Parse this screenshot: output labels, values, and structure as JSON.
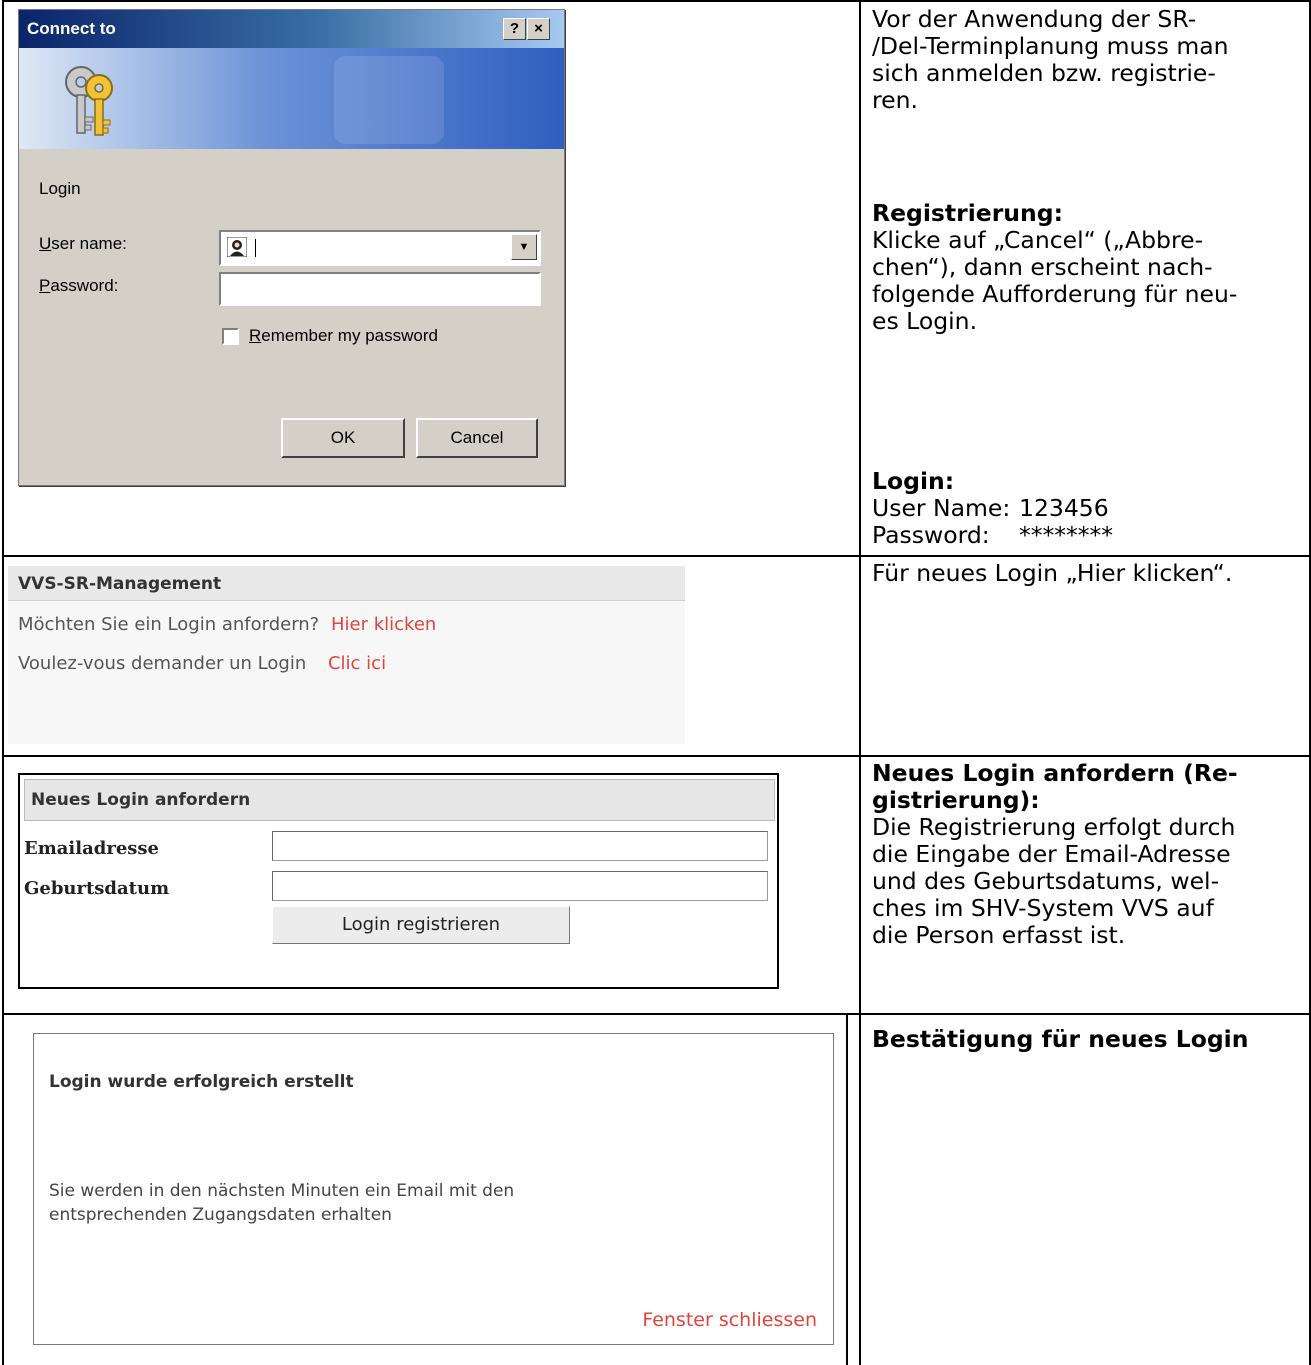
{
  "dialog": {
    "title": "Connect to",
    "help_btn": "?",
    "close_btn": "×",
    "section_label": "Login",
    "user_label_u": "U",
    "user_label_rest": "ser name:",
    "password_label_u": "P",
    "password_label_rest": "assword:",
    "remember_u": "R",
    "remember_rest": "emember my password",
    "ok": "OK",
    "cancel": "Cancel"
  },
  "desc1": {
    "intro": [
      "Vor der Anwendung der SR-",
      "/Del-Terminplanung muss man",
      "sich anmelden bzw. registrie-",
      "ren."
    ],
    "reg_heading": "Registrierung:",
    "reg_text": [
      "Klicke auf „Cancel“ („Abbre-",
      "chen“), dann erscheint nach-",
      "folgende Aufforderung für neu-",
      "es Login."
    ],
    "login_heading": "Login:",
    "user_key": "User Name:",
    "user_val": "123456",
    "pass_key": "Password:",
    "pass_val": "********"
  },
  "vvs": {
    "header": "VVS-SR-Management",
    "q_de": "Möchten Sie ein Login anfordern?",
    "link_de": "Hier klicken",
    "q_fr": "Voulez-vous demander un Login",
    "link_fr": "Clic ici"
  },
  "desc2": {
    "text": "Für neues Login „Hier klicken“."
  },
  "nla": {
    "header": "Neues Login anfordern",
    "email_label": "Emailadresse",
    "birth_label": "Geburtsdatum",
    "button": "Login registrieren"
  },
  "desc3": {
    "heading": [
      "Neues Login anfordern (Re-",
      "gistrierung):"
    ],
    "text": [
      "Die Registrierung erfolgt durch",
      "die Eingabe der Email-Adresse",
      "und des Geburtsdatums, wel-",
      "ches im SHV-System VVS auf",
      "die Person erfasst ist."
    ]
  },
  "conf": {
    "title": "Login wurde erfolgreich erstellt",
    "msg1": "Sie werden in den nächsten Minuten ein Email mit den",
    "msg2": "entsprechenden Zugangsdaten erhalten",
    "close": "Fenster schliessen"
  },
  "desc4": {
    "heading": "Bestätigung für neues Login"
  }
}
